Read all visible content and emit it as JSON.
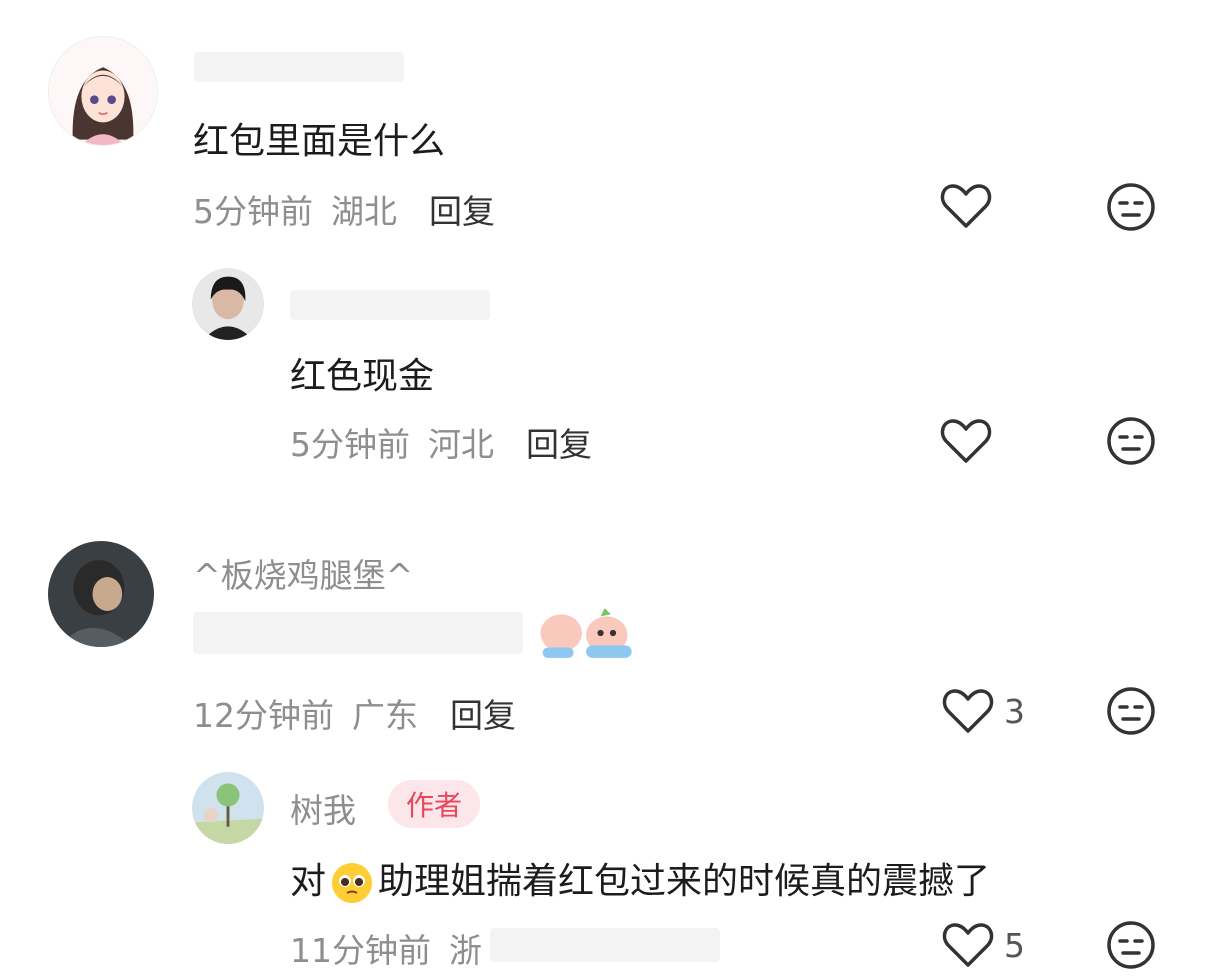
{
  "comments": [
    {
      "text": "红包里面是什么",
      "time": "5分钟前",
      "location": "湖北",
      "reply_label": "回复"
    },
    {
      "text": "红色现金",
      "time": "5分钟前",
      "location": "河北",
      "reply_label": "回复"
    },
    {
      "username": "^板烧鸡腿堡^",
      "time": "12分钟前",
      "location": "广东",
      "reply_label": "回复",
      "likes": "3"
    },
    {
      "username": "树我",
      "badge": "作者",
      "text_a": "对",
      "text_b": "助理姐揣着红包过来的时候真的震撼了",
      "time": "11分钟前",
      "location": "浙",
      "likes": "5"
    }
  ],
  "icons": {
    "like": "heart-icon",
    "dislike": "dislike-face-icon"
  }
}
